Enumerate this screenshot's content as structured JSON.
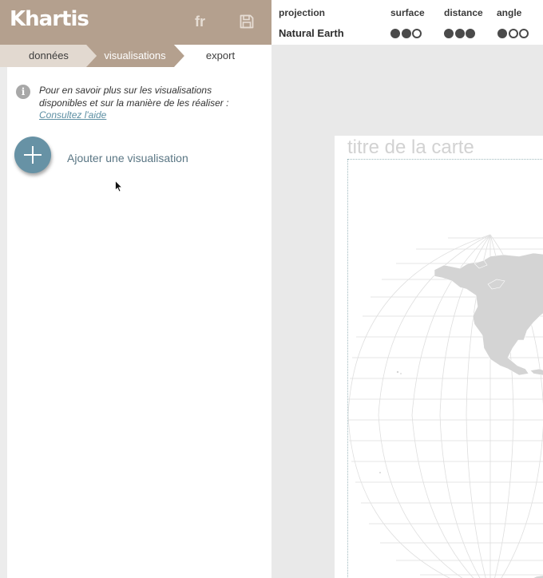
{
  "header": {
    "logo": "Khartis",
    "lang_label": "fr",
    "save_icon": "floppy-disk-icon",
    "background_color": "#b4a08e"
  },
  "steps": {
    "items": [
      {
        "label": "données",
        "active": false
      },
      {
        "label": "visualisations",
        "active": true
      },
      {
        "label": "export",
        "active": false
      }
    ],
    "active_color": "#b4a08e"
  },
  "info": {
    "icon": "info-icon",
    "text": "Pour en savoir plus sur les visualisations disponibles et sur la manière de les réaliser :",
    "link_text": "Consultez l'aide"
  },
  "add_visualisation": {
    "icon": "plus-icon",
    "label": "Ajouter une visualisation",
    "button_color": "#6792a5"
  },
  "projection_panel": {
    "headers": {
      "projection": "projection",
      "surface": "surface",
      "distance": "distance",
      "angle": "angle"
    },
    "projection_name": "Natural Earth",
    "ratings": {
      "surface": 2,
      "distance": 3,
      "angle": 1,
      "max": 3
    }
  },
  "map": {
    "title": "titre de la carte",
    "land_color": "#d4d4d4",
    "graticule_color": "#dedede"
  }
}
